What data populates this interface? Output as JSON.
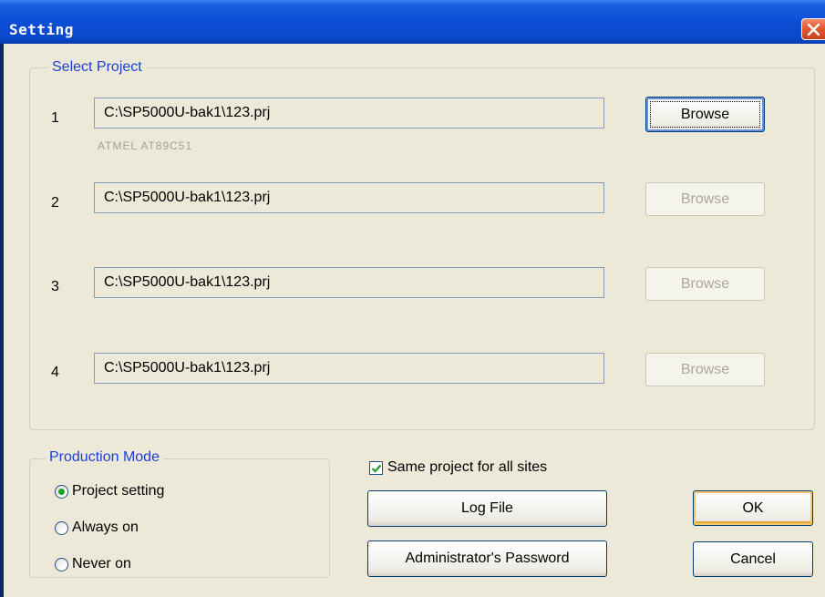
{
  "window": {
    "title": "Setting"
  },
  "select_project": {
    "legend": "Select Project",
    "rows": [
      {
        "num": "1",
        "path": "C:\\SP5000U-bak1\\123.prj",
        "device": "ATMEL AT89C51",
        "browse_label": "Browse",
        "browse_enabled": true
      },
      {
        "num": "2",
        "path": "C:\\SP5000U-bak1\\123.prj",
        "browse_label": "Browse",
        "browse_enabled": false
      },
      {
        "num": "3",
        "path": "C:\\SP5000U-bak1\\123.prj",
        "browse_label": "Browse",
        "browse_enabled": false
      },
      {
        "num": "4",
        "path": "C:\\SP5000U-bak1\\123.prj",
        "browse_label": "Browse",
        "browse_enabled": false
      }
    ]
  },
  "production_mode": {
    "legend": "Production Mode",
    "options": [
      {
        "label": "Project setting",
        "checked": true
      },
      {
        "label": "Always on",
        "checked": false
      },
      {
        "label": "Never on",
        "checked": false
      }
    ]
  },
  "same_project": {
    "label": "Same project for all sites",
    "checked": true
  },
  "buttons": {
    "log_file": "Log File",
    "admin_password": "Administrator's Password",
    "ok": "OK",
    "cancel": "Cancel"
  },
  "icons": {
    "close": "close-icon",
    "check": "checkmark-icon"
  },
  "colors": {
    "title_bar": "#0c4ed6",
    "group_legend": "#1e3fd4",
    "dialog_bg": "#ece9d8",
    "close_button": "#e05a2e",
    "radio_dot": "#21a121"
  }
}
